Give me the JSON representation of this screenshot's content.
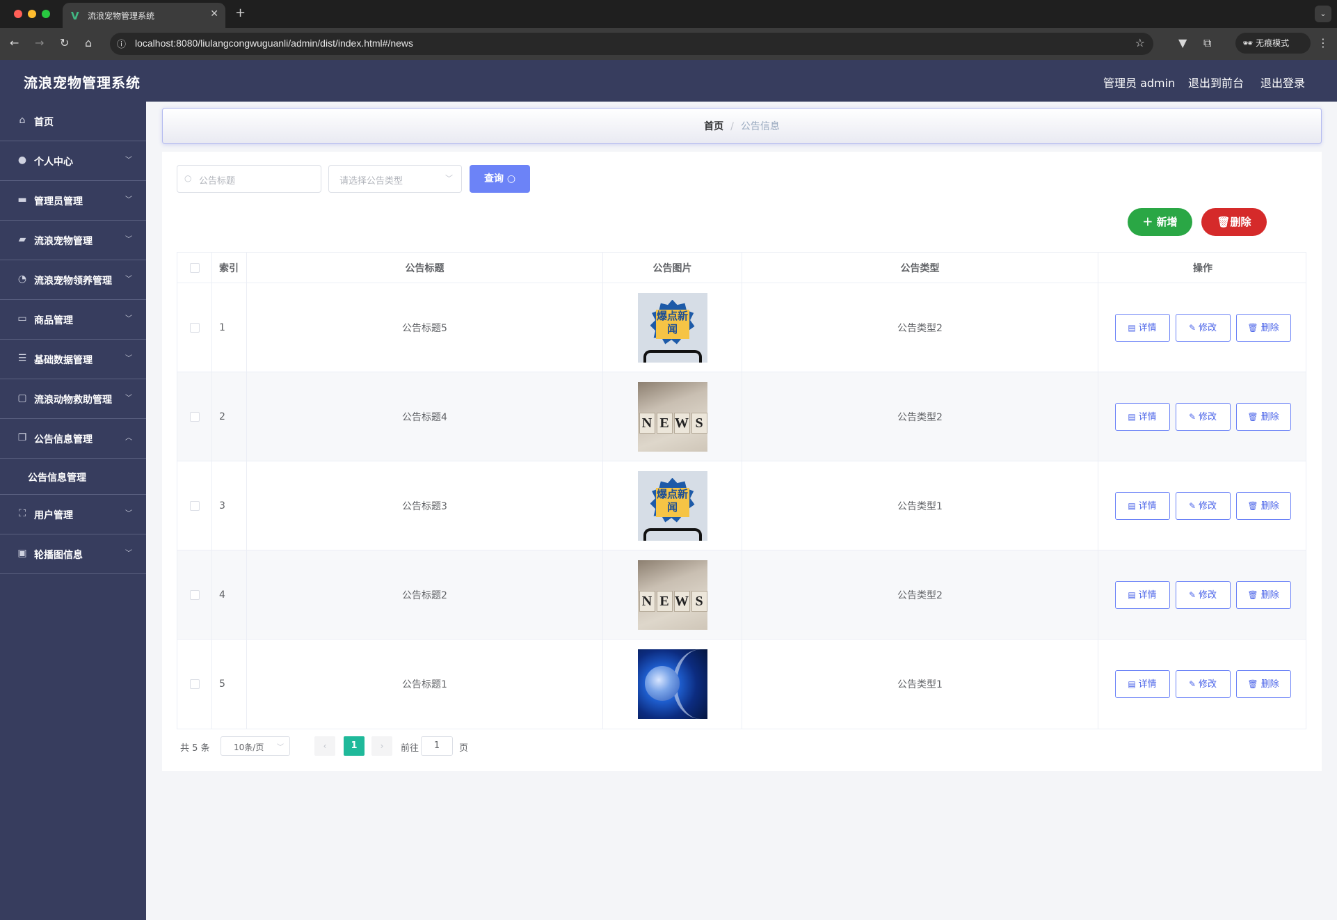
{
  "browser": {
    "tab_title": "流浪宠物管理系统",
    "url": "localhost:8080/liulangcongwuguanli/admin/dist/index.html#/news",
    "incognito_label": "无痕模式"
  },
  "header": {
    "title": "流浪宠物管理系统",
    "user": "管理员 admin",
    "to_front": "退出到前台",
    "logout": "退出登录"
  },
  "sidebar": {
    "items": [
      {
        "label": "首页",
        "icon": "home-icon"
      },
      {
        "label": "个人中心",
        "icon": "user-icon"
      },
      {
        "label": "管理员管理",
        "icon": "briefcase-icon"
      },
      {
        "label": "流浪宠物管理",
        "icon": "truck-icon"
      },
      {
        "label": "流浪宠物领养管理",
        "icon": "gauge-icon"
      },
      {
        "label": "商品管理",
        "icon": "card-icon"
      },
      {
        "label": "基础数据管理",
        "icon": "list-icon"
      },
      {
        "label": "流浪动物救助管理",
        "icon": "chat-icon"
      },
      {
        "label": "公告信息管理",
        "icon": "copy-icon"
      },
      {
        "label": "用户管理",
        "icon": "fullscreen-icon"
      },
      {
        "label": "轮播图信息",
        "icon": "clipboard-icon"
      }
    ],
    "sub_item": "公告信息管理"
  },
  "breadcrumb": {
    "home": "首页",
    "current": "公告信息"
  },
  "search": {
    "title_placeholder": "公告标题",
    "type_placeholder": "请选择公告类型",
    "query_label": "查询"
  },
  "actions": {
    "add_label": "新增",
    "delete_label": "删除"
  },
  "table": {
    "headers": [
      "索引",
      "公告标题",
      "公告图片",
      "公告类型",
      "操作"
    ],
    "rows": [
      {
        "index": "1",
        "title": "公告标题5",
        "image": "baodian",
        "type": "公告类型2"
      },
      {
        "index": "2",
        "title": "公告标题4",
        "image": "news",
        "type": "公告类型2"
      },
      {
        "index": "3",
        "title": "公告标题3",
        "image": "baodian",
        "type": "公告类型1"
      },
      {
        "index": "4",
        "title": "公告标题2",
        "image": "news",
        "type": "公告类型2"
      },
      {
        "index": "5",
        "title": "公告标题1",
        "image": "globe",
        "type": "公告类型1"
      }
    ],
    "op_detail": "详情",
    "op_edit": "修改",
    "op_delete": "删除"
  },
  "thumb_text": {
    "baodian": "爆点新闻",
    "news": [
      "N",
      "E",
      "W",
      "S"
    ]
  },
  "pagination": {
    "total": "共 5 条",
    "page_size": "10条/页",
    "current_page": "1",
    "goto_label": "前往",
    "goto_value": "1",
    "goto_unit": "页"
  },
  "colors": {
    "header_bg": "#373d5e",
    "primary": "#6c83f7",
    "success": "#2aa745",
    "danger": "#d52a2a",
    "page_active": "#1fb99a"
  }
}
